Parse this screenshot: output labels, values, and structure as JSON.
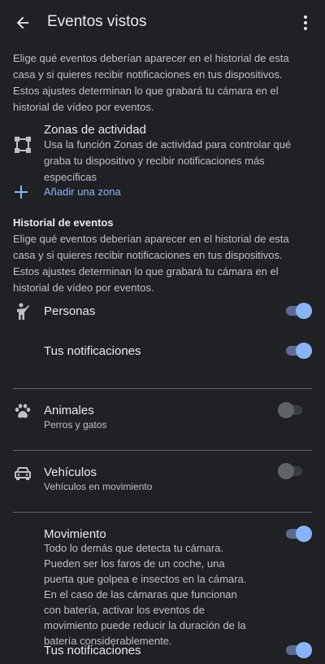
{
  "header": {
    "title": "Eventos vistos",
    "back_icon": "arrow-back-icon",
    "more_icon": "more-vert-icon"
  },
  "intro": "Elige qué eventos deberían aparecer en el historial de esta casa y si quieres recibir notificaciones en tus dispositivos. Estos ajustes determinan lo que grabará tu cámara en el historial de vídeo por eventos.",
  "activity_zones": {
    "title": "Zonas de actividad",
    "description": "Usa la función Zonas de actividad para controlar qué graba tu dispositivo y recibir notificaciones más específicas",
    "add_label": "Añadir una zona"
  },
  "history": {
    "title": "Historial de eventos",
    "description": "Elige qué eventos deberían aparecer en el historial de esta casa y si quieres recibir notificaciones en tus dispositivos. Estos ajustes determinan lo que grabará tu cámara en el historial de vídeo por eventos."
  },
  "events": {
    "persons": {
      "label": "Personas",
      "enabled": true,
      "notifications_label": "Tus notificaciones",
      "notifications_enabled": true
    },
    "animals": {
      "label": "Animales",
      "subtitle": "Perros y gatos",
      "enabled": false
    },
    "vehicles": {
      "label": "Vehículos",
      "subtitle": "Vehículos en movimiento",
      "enabled": false
    },
    "motion": {
      "label": "Movimiento",
      "description": "Todo lo demás que detecta tu cámara. Pueden ser los faros de un coche, una puerta que golpea e insectos en la cámara. En el caso de las cámaras que funcionan con batería, activar los eventos de movimiento puede reducir la duración de la batería considerablemente.",
      "enabled": true,
      "notifications_label": "Tus notificaciones",
      "notifications_enabled": true
    }
  },
  "colors": {
    "background": "#202124",
    "accent": "#8ab4f8",
    "text_primary": "#e8eaed",
    "text_secondary": "#bdc1c6",
    "divider": "#5f6368"
  }
}
